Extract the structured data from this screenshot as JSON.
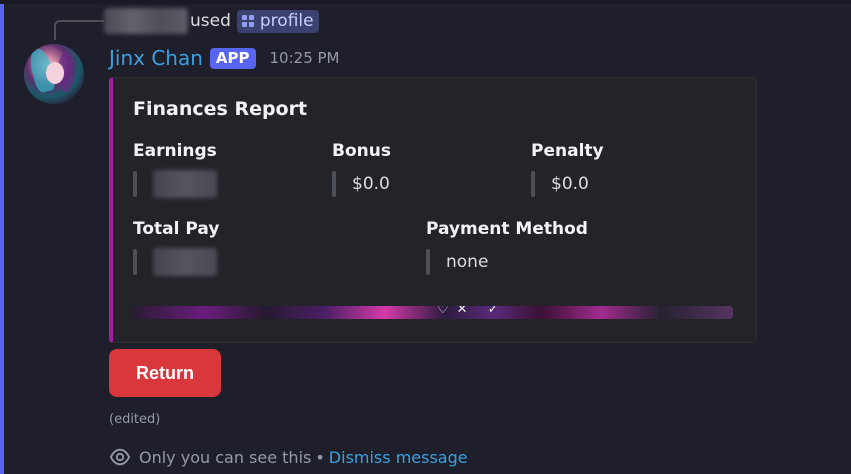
{
  "interaction": {
    "used_text": "used",
    "command_name": "profile",
    "command_icon": "slash-command-icon"
  },
  "message": {
    "avatar_icon": "user-avatar",
    "username": "Jinx Chan",
    "app_badge": "APP",
    "timestamp": "10:25 PM",
    "edited_label": "(edited)"
  },
  "embed": {
    "accent_color": "#a3209a",
    "title": "Finances Report",
    "fields": {
      "earnings": {
        "name": "Earnings",
        "value": ""
      },
      "bonus": {
        "name": "Bonus",
        "value": "$0.0"
      },
      "penalty": {
        "name": "Penalty",
        "value": "$0.0"
      },
      "total_pay": {
        "name": "Total Pay",
        "value": ""
      },
      "payment_method": {
        "name": "Payment Method",
        "value": "none"
      }
    }
  },
  "buttons": {
    "return_label": "Return",
    "return_color": "#da373c"
  },
  "ephemeral": {
    "notice": "Only you can see this",
    "separator": "•",
    "dismiss_label": "Dismiss message"
  },
  "colors": {
    "background": "#1f1f2b",
    "username": "#3ba0e0",
    "badge": "#5865f2",
    "link": "#3ba0e0"
  }
}
